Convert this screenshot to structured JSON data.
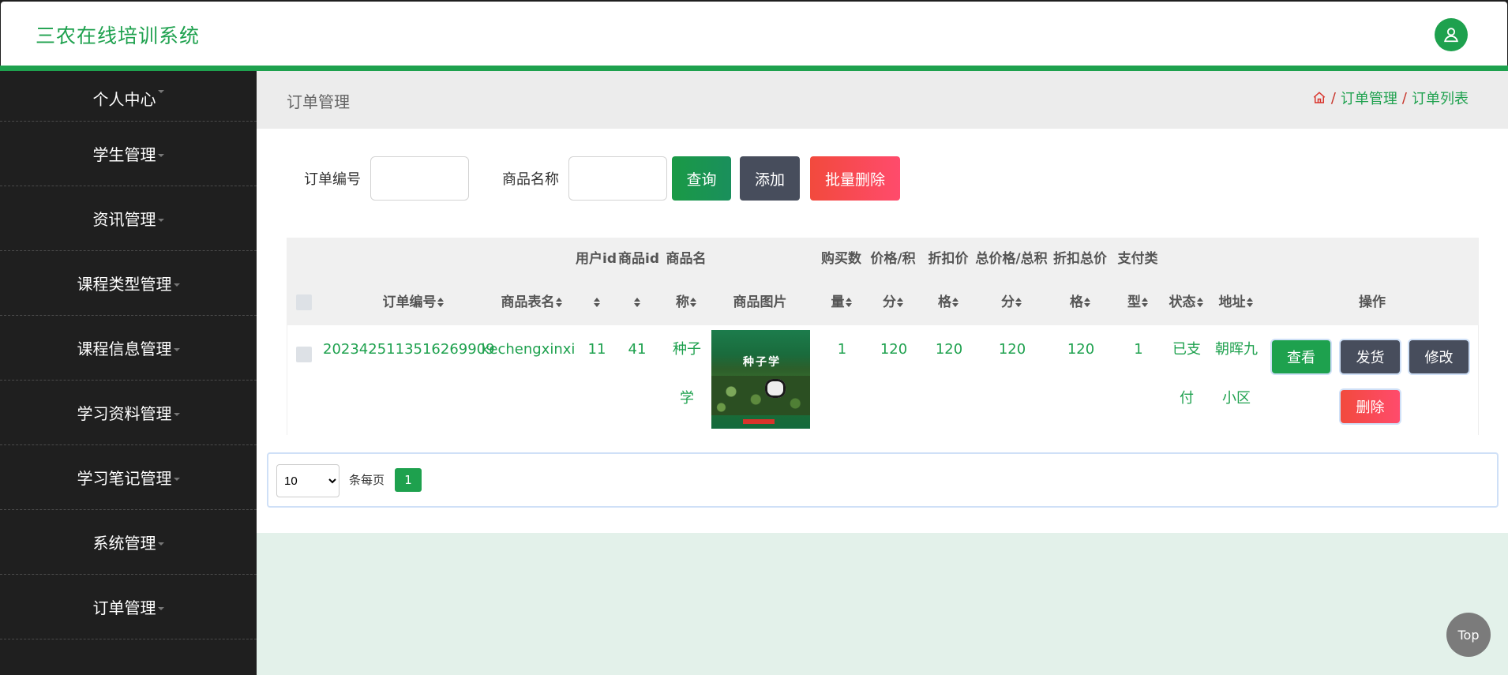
{
  "app": {
    "title": "三农在线培训系统"
  },
  "sidebar": {
    "items": [
      {
        "label": "个人中心"
      },
      {
        "label": "学生管理"
      },
      {
        "label": "资讯管理"
      },
      {
        "label": "课程类型管理"
      },
      {
        "label": "课程信息管理"
      },
      {
        "label": "学习资料管理"
      },
      {
        "label": "学习笔记管理"
      },
      {
        "label": "系统管理"
      },
      {
        "label": "订单管理"
      }
    ]
  },
  "page": {
    "title": "订单管理",
    "breadcrumb": {
      "sep": "/",
      "level1": "订单管理",
      "level2": "订单列表"
    }
  },
  "search": {
    "order_no_label": "订单编号",
    "order_no_value": "",
    "goods_name_label": "商品名称",
    "goods_name_value": "",
    "query_label": "查询",
    "add_label": "添加",
    "batch_delete_label": "批量删除"
  },
  "table": {
    "headers": {
      "order_no": "订单编号",
      "goods_table": "商品表名",
      "user_id": "用户id",
      "goods_id": "商品id",
      "goods_name_1": "商品名",
      "goods_name_2": "称",
      "goods_image": "商品图片",
      "buy_count_1": "购买数",
      "buy_count_2": "量",
      "price_1": "价格/积",
      "price_2": "分",
      "discount_price_1": "折扣价",
      "discount_price_2": "格",
      "total_price_1": "总价格/总积",
      "total_price_2": "分",
      "discount_total_1": "折扣总价",
      "discount_total_2": "格",
      "pay_type_1": "支付类",
      "pay_type_2": "型",
      "status": "状态",
      "address": "地址",
      "actions": "操作"
    },
    "rows": [
      {
        "order_no": "2023425113516269909",
        "goods_table": "kechengxinxi",
        "user_id": "11",
        "goods_id": "41",
        "goods_name_1": "种子",
        "goods_name_2": "学",
        "image_title": "种子学",
        "buy_count": "1",
        "price": "120",
        "discount_price": "120",
        "total_price": "120",
        "discount_total": "120",
        "pay_type": "1",
        "status_1": "已支",
        "status_2": "付",
        "address_1": "朝晖九",
        "address_2": "小区",
        "view_label": "查看",
        "ship_label": "发货",
        "edit_label": "修改",
        "delete_label": "删除"
      }
    ]
  },
  "pagination": {
    "page_size": "10",
    "per_page_label": "条每页",
    "current_page": "1"
  },
  "back_to_top": "Top",
  "colors": {
    "accent": "#1ea14e",
    "sidebar_bg": "#1f1f1f",
    "dark_button": "#474d5c",
    "danger": "#f24a3d",
    "content_bg": "#e3f1ea"
  }
}
